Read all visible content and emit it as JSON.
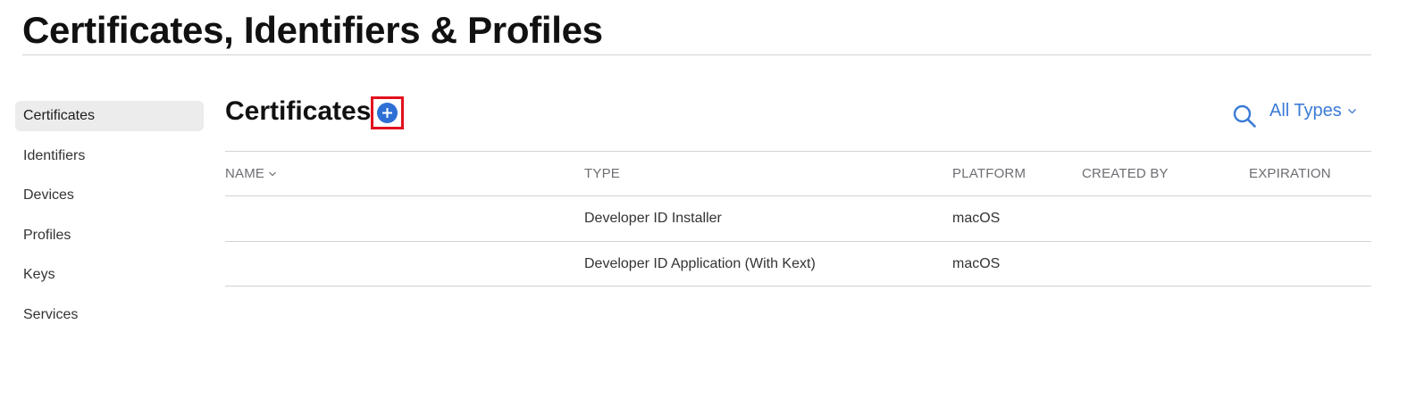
{
  "page_title": "Certificates, Identifiers & Profiles",
  "sidebar": {
    "items": [
      {
        "label": "Certificates",
        "active": true
      },
      {
        "label": "Identifiers"
      },
      {
        "label": "Devices"
      },
      {
        "label": "Profiles"
      },
      {
        "label": "Keys"
      },
      {
        "label": "Services"
      }
    ]
  },
  "main": {
    "section_title": "Certificates",
    "add_icon": "plus-circle-icon",
    "search_icon": "search-icon",
    "filter_label": "All Types",
    "accent_color": "#3b7bd6",
    "highlight_color": "#e2101e"
  },
  "table": {
    "columns": [
      "NAME",
      "TYPE",
      "PLATFORM",
      "CREATED BY",
      "EXPIRATION"
    ],
    "rows": [
      {
        "name": "",
        "type": "Developer ID Installer",
        "platform": "macOS",
        "created_by": "",
        "expiration": ""
      },
      {
        "name": "",
        "type": "Developer ID Application (With Kext)",
        "platform": "macOS",
        "created_by": "",
        "expiration": ""
      }
    ]
  }
}
